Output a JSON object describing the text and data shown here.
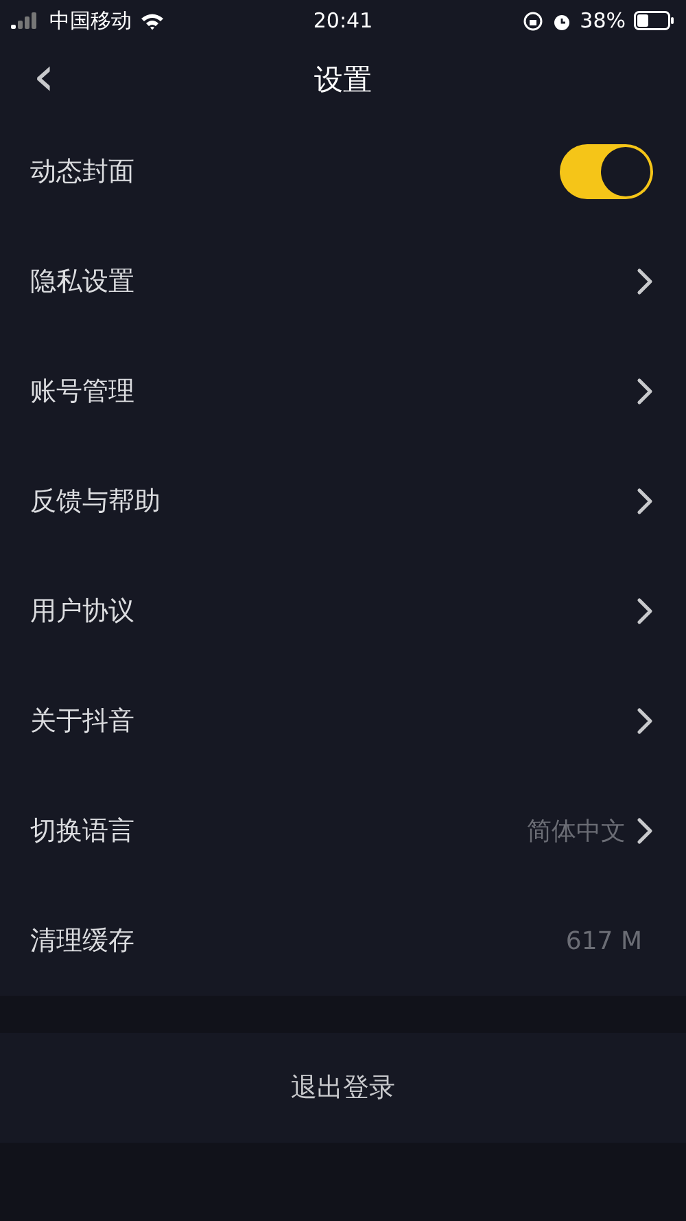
{
  "status_bar": {
    "carrier": "中国移动",
    "time": "20:41",
    "battery": "38%"
  },
  "nav": {
    "back": "‹",
    "title": "设置"
  },
  "rows": [
    {
      "kind": "toggle",
      "label": "动态封面",
      "on": true
    },
    {
      "kind": "link",
      "label": "隐私设置"
    },
    {
      "kind": "link",
      "label": "账号管理"
    },
    {
      "kind": "link",
      "label": "反馈与帮助"
    },
    {
      "kind": "link",
      "label": "用户协议"
    },
    {
      "kind": "link",
      "label": "关于抖音"
    },
    {
      "kind": "link",
      "label": "切换语言",
      "value": "简体中文"
    },
    {
      "kind": "value",
      "label": "清理缓存",
      "value": "617 M"
    }
  ],
  "logout": "退出登录"
}
